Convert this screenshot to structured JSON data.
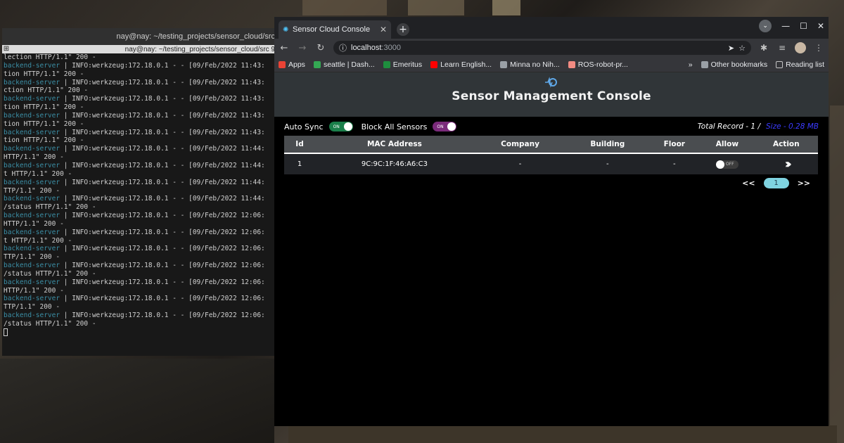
{
  "terminal": {
    "title": "nay@nay: ~/testing_projects/sensor_cloud/src",
    "tab_title": "nay@nay: ~/testing_projects/sensor_cloud/src 9",
    "lines": [
      {
        "server": "",
        "text": "lection HTTP/1.1\" 200 -"
      },
      {
        "server": "backend-server",
        "text": " | INFO:werkzeug:172.18.0.1 - - [09/Feb/2022 11:43:"
      },
      {
        "server": "",
        "text": "tion HTTP/1.1\" 200 -"
      },
      {
        "server": "backend-server",
        "text": " | INFO:werkzeug:172.18.0.1 - - [09/Feb/2022 11:43:"
      },
      {
        "server": "",
        "text": "ction HTTP/1.1\" 200 -"
      },
      {
        "server": "backend-server",
        "text": " | INFO:werkzeug:172.18.0.1 - - [09/Feb/2022 11:43:"
      },
      {
        "server": "",
        "text": "tion HTTP/1.1\" 200 -"
      },
      {
        "server": "backend-server",
        "text": " | INFO:werkzeug:172.18.0.1 - - [09/Feb/2022 11:43:"
      },
      {
        "server": "",
        "text": "tion HTTP/1.1\" 200 -"
      },
      {
        "server": "backend-server",
        "text": " | INFO:werkzeug:172.18.0.1 - - [09/Feb/2022 11:43:"
      },
      {
        "server": "",
        "text": "tion HTTP/1.1\" 200 -"
      },
      {
        "server": "backend-server",
        "text": " | INFO:werkzeug:172.18.0.1 - - [09/Feb/2022 11:44:"
      },
      {
        "server": "",
        "text": "HTTP/1.1\" 200 -"
      },
      {
        "server": "backend-server",
        "text": " | INFO:werkzeug:172.18.0.1 - - [09/Feb/2022 11:44:"
      },
      {
        "server": "",
        "text": "t HTTP/1.1\" 200 -"
      },
      {
        "server": "backend-server",
        "text": " | INFO:werkzeug:172.18.0.1 - - [09/Feb/2022 11:44:"
      },
      {
        "server": "",
        "text": "TTP/1.1\" 200 -"
      },
      {
        "server": "backend-server",
        "text": " | INFO:werkzeug:172.18.0.1 - - [09/Feb/2022 11:44:"
      },
      {
        "server": "",
        "text": "/status HTTP/1.1\" 200 -"
      },
      {
        "server": "backend-server",
        "text": " | INFO:werkzeug:172.18.0.1 - - [09/Feb/2022 12:06:"
      },
      {
        "server": "",
        "text": "HTTP/1.1\" 200 -"
      },
      {
        "server": "backend-server",
        "text": " | INFO:werkzeug:172.18.0.1 - - [09/Feb/2022 12:06:"
      },
      {
        "server": "",
        "text": "t HTTP/1.1\" 200 -"
      },
      {
        "server": "backend-server",
        "text": " | INFO:werkzeug:172.18.0.1 - - [09/Feb/2022 12:06:"
      },
      {
        "server": "",
        "text": "TTP/1.1\" 200 -"
      },
      {
        "server": "backend-server",
        "text": " | INFO:werkzeug:172.18.0.1 - - [09/Feb/2022 12:06:"
      },
      {
        "server": "",
        "text": "/status HTTP/1.1\" 200 -"
      },
      {
        "server": "backend-server",
        "text": " | INFO:werkzeug:172.18.0.1 - - [09/Feb/2022 12:06:"
      },
      {
        "server": "",
        "text": "HTTP/1.1\" 200 -"
      },
      {
        "server": "backend-server",
        "text": " | INFO:werkzeug:172.18.0.1 - - [09/Feb/2022 12:06:"
      },
      {
        "server": "",
        "text": "TTP/1.1\" 200 -"
      },
      {
        "server": "backend-server",
        "text": " | INFO:werkzeug:172.18.0.1 - - [09/Feb/2022 12:06:"
      },
      {
        "server": "",
        "text": "/status HTTP/1.1\" 200 -"
      }
    ]
  },
  "browser": {
    "tab_title": "Sensor Cloud Console",
    "url_host": "localhost",
    "url_port": ":3000",
    "bookmarks": [
      {
        "label": "Apps",
        "icon": "apps-grid-icon",
        "color": "#ea4335"
      },
      {
        "label": "seattle | Dash...",
        "icon": "dashboard-icon",
        "color": "#34a853"
      },
      {
        "label": "Emeritus",
        "icon": "emeritus-icon",
        "color": "#1e8e3e"
      },
      {
        "label": "Learn English...",
        "icon": "youtube-icon",
        "color": "#ff0000"
      },
      {
        "label": "Minna no Nih...",
        "icon": "globe-icon",
        "color": "#9aa0a6"
      },
      {
        "label": "ROS-robot-pr...",
        "icon": "ros-icon",
        "color": "#f28b82"
      }
    ],
    "overflow": "»",
    "other_bookmarks": "Other bookmarks",
    "reading_list": "Reading list"
  },
  "app": {
    "title": "Sensor Management Console",
    "auto_sync_label": "Auto Sync",
    "auto_sync_state": "ON",
    "block_all_label": "Block All Sensors",
    "block_all_state": "ON",
    "total_record": "Total Record - 1 /",
    "size": "Size - 0.28 MB",
    "columns": [
      "Id",
      "MAC Address",
      "Company",
      "Building",
      "Floor",
      "Allow",
      "Action"
    ],
    "rows": [
      {
        "id": "1",
        "mac": "9C:9C:1F:46:A6:C3",
        "company": "-",
        "building": "-",
        "floor": "-",
        "allow": "OFF"
      }
    ],
    "pager": {
      "prev": "<<",
      "current": "1",
      "next": ">>"
    }
  },
  "colors": {
    "server_tag": "#3b8ea5",
    "auto_sync_toggle": "#1a7f4a",
    "block_toggle": "#7a2a7a",
    "size_text": "#3b3bff",
    "pager_active": "#7fd3e0"
  }
}
